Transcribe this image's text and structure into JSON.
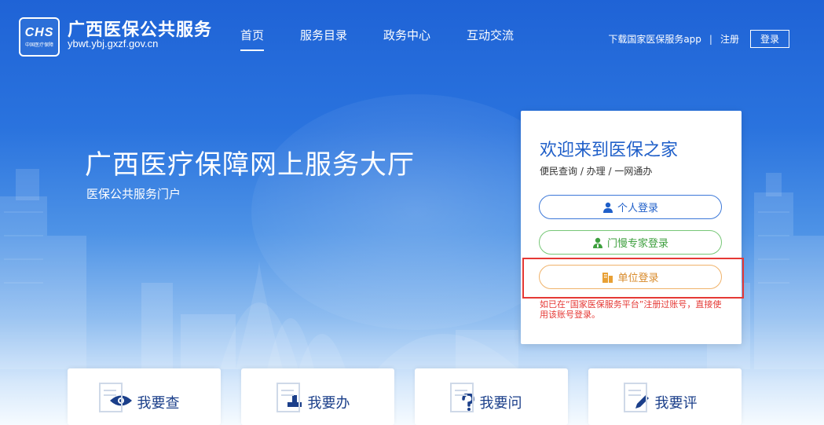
{
  "colors": {
    "brand_blue": "#1f63d6",
    "title_blue": "#1f5fc9",
    "person_border": "#3c78d8",
    "expert_green": "#3d9f3d",
    "unit_orange": "#d88a2a",
    "notice_red": "#e53935",
    "card_label": "#1b3f8a"
  },
  "header": {
    "logo_mark": "CHS",
    "logo_sub": "中国医疗保障",
    "site_title": "广西医保公共服务",
    "site_domain": "ybwt.ybj.gxzf.gov.cn",
    "nav": [
      {
        "label": "首页",
        "active": true
      },
      {
        "label": "服务目录"
      },
      {
        "label": "政务中心"
      },
      {
        "label": "互动交流"
      }
    ],
    "download_app": "下载国家医保服务app",
    "separator": "|",
    "register": "注册",
    "login": "登录"
  },
  "hero": {
    "title": "广西医疗保障网上服务大厅",
    "subtitle": "医保公共服务门户"
  },
  "panel": {
    "title": "欢迎来到医保之家",
    "subtitle": "便民查询 / 办理 / 一网通办",
    "buttons": {
      "person": {
        "icon": "person-icon",
        "label": "个人登录"
      },
      "expert": {
        "icon": "doctor-icon",
        "label": "门慢专家登录"
      },
      "unit": {
        "icon": "building-icon",
        "label": "单位登录"
      }
    },
    "notice": "如已在“国家医保服务平台”注册过账号，直接使用该账号登录。"
  },
  "cards": [
    {
      "icon": "eye-icon",
      "label": "我要查"
    },
    {
      "icon": "stamp-icon",
      "label": "我要办"
    },
    {
      "icon": "question-icon",
      "label": "我要问"
    },
    {
      "icon": "pen-icon",
      "label": "我要评"
    }
  ]
}
